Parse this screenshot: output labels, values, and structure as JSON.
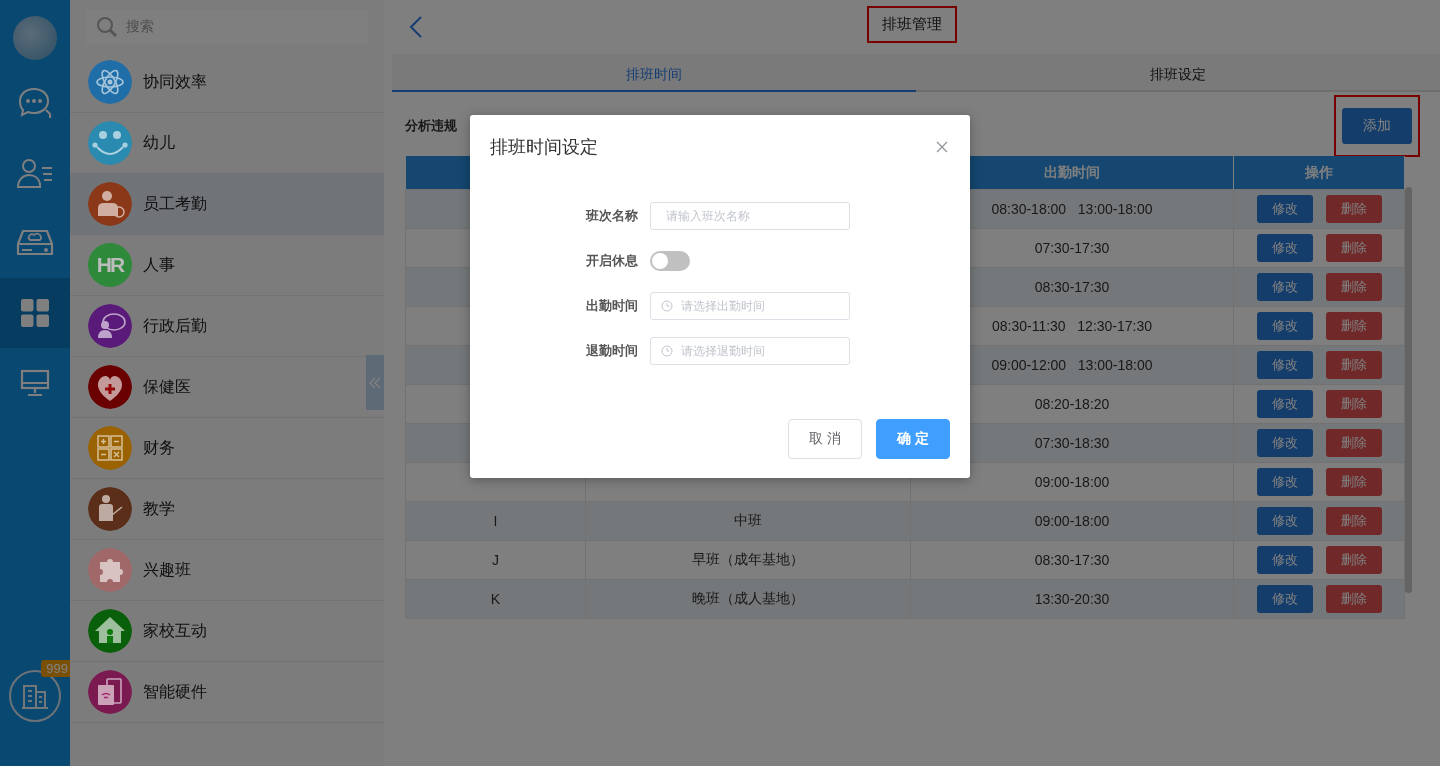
{
  "rail": {
    "items": [
      {
        "kind": "chat",
        "selected": false
      },
      {
        "kind": "contacts",
        "selected": false
      },
      {
        "kind": "drive",
        "selected": false
      },
      {
        "kind": "apps",
        "selected": true
      },
      {
        "kind": "monitor",
        "selected": false
      }
    ],
    "badge": "999"
  },
  "sidebar": {
    "search_placeholder": "搜索",
    "items": [
      {
        "label": "协同效率",
        "color": "#1f6ea8",
        "selected": false
      },
      {
        "label": "幼儿",
        "color": "#2a8ab0",
        "selected": false
      },
      {
        "label": "员工考勤",
        "color": "#8a3818",
        "selected": true
      },
      {
        "label": "人事",
        "color": "#2e8a3a",
        "selected": false,
        "icon_text": "HR"
      },
      {
        "label": "行政后勤",
        "color": "#5a1a7a",
        "selected": false
      },
      {
        "label": "保健医",
        "color": "#6a0000",
        "selected": false
      },
      {
        "label": "财务",
        "color": "#9a6200",
        "selected": false
      },
      {
        "label": "教学",
        "color": "#5a2e18",
        "selected": false
      },
      {
        "label": "兴趣班",
        "color": "#a06868",
        "selected": false
      },
      {
        "label": "家校互动",
        "color": "#0a600a",
        "selected": false
      },
      {
        "label": "智能硬件",
        "color": "#7a1a50",
        "selected": false
      }
    ]
  },
  "header": {
    "title": "排班管理"
  },
  "tabs": [
    {
      "label": "排班时间",
      "selected": true
    },
    {
      "label": "排班设定",
      "selected": false
    }
  ],
  "toolbar": {
    "label": "分析违规",
    "add_button": "添加"
  },
  "table": {
    "columns": [
      {
        "label": "出勤时间"
      },
      {
        "label": "操作"
      }
    ],
    "rows": [
      {
        "time": "08:30-18:00   13:00-18:00",
        "edit": "修改",
        "delete": "删除"
      },
      {
        "time": "07:30-17:30",
        "edit": "修改",
        "delete": "删除"
      },
      {
        "time": "08:30-17:30",
        "edit": "修改",
        "delete": "删除"
      },
      {
        "time": "08:30-11:30   12:30-17:30",
        "edit": "修改",
        "delete": "删除"
      },
      {
        "time": "09:00-12:00   13:00-18:00",
        "edit": "修改",
        "delete": "删除"
      },
      {
        "time": "08:20-18:20",
        "edit": "修改",
        "delete": "删除"
      },
      {
        "time": "07:30-18:30",
        "edit": "修改",
        "delete": "删除"
      },
      {
        "time": "09:00-18:00",
        "edit": "修改",
        "delete": "删除"
      },
      {
        "column_1": "I",
        "column_2": "中班",
        "time": "09:00-18:00",
        "edit": "修改",
        "delete": "删除"
      },
      {
        "column_1": "J",
        "column_2": "早班（成年基地）",
        "time": "08:30-17:30",
        "edit": "修改",
        "delete": "删除"
      },
      {
        "column_1": "K",
        "column_2": "晚班（成人基地）",
        "time": "13:30-20:30",
        "edit": "修改",
        "delete": "删除"
      }
    ]
  },
  "dialog": {
    "title": "排班时间设定",
    "fields": [
      {
        "kind": "text",
        "label": "班次名称",
        "placeholder": "请输入班次名称"
      },
      {
        "kind": "switch",
        "label": "开启休息",
        "on": false
      },
      {
        "kind": "time",
        "label": "出勤时间",
        "placeholder": "请选择出勤时间"
      },
      {
        "kind": "time",
        "label": "退勤时间",
        "placeholder": "请选择退勤时间"
      }
    ],
    "buttons": [
      {
        "kind": "secondary",
        "label": "取 消"
      },
      {
        "kind": "primary",
        "label": "确 定"
      }
    ]
  }
}
